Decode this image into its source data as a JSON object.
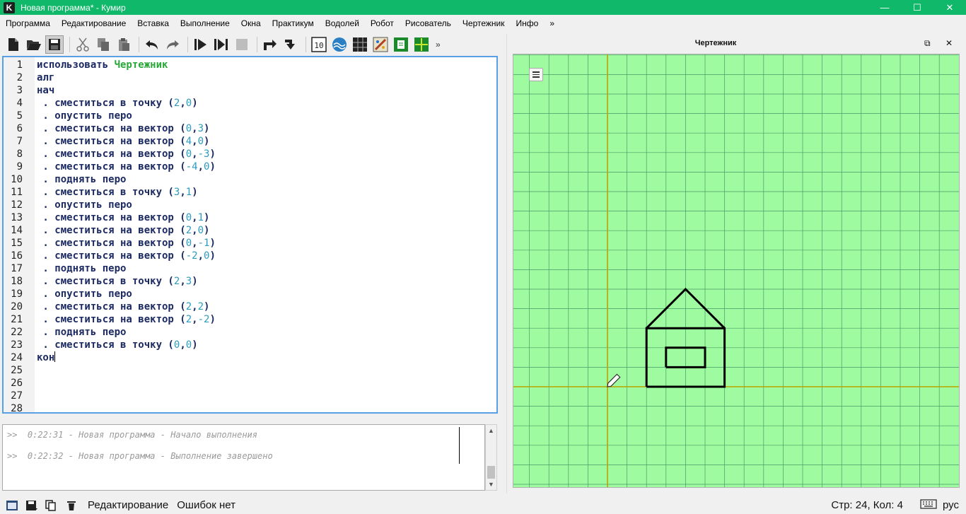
{
  "window": {
    "app_icon_letter": "K",
    "title": "Новая программа* - Кумир",
    "minimize": "—",
    "maximize": "☐",
    "close": "✕"
  },
  "menu": [
    "Программа",
    "Редактирование",
    "Вставка",
    "Выполнение",
    "Окна",
    "Практикум",
    "Водолей",
    "Робот",
    "Рисователь",
    "Чертежник",
    "Инфо",
    "»"
  ],
  "toolbar": {
    "icons": [
      "new-file-icon",
      "open-folder-icon",
      "save-icon",
      "cut-icon",
      "copy-icon",
      "paste-icon",
      "undo-icon",
      "redo-icon",
      "run-icon",
      "step-run-icon",
      "stop-icon",
      "step-over-icon",
      "step-into-icon",
      "counter-icon",
      "vodoley-icon",
      "robot-icon",
      "drawer-icon",
      "draftsman-icon",
      "grid-icon"
    ],
    "more": "»"
  },
  "editor": {
    "lines": [
      {
        "n": "1",
        "segs": [
          {
            "t": "использовать ",
            "c": "kw"
          },
          {
            "t": "Чертежник",
            "c": "mod"
          }
        ]
      },
      {
        "n": "2",
        "segs": [
          {
            "t": "алг",
            "c": "kw"
          }
        ]
      },
      {
        "n": "3",
        "segs": [
          {
            "t": "нач",
            "c": "kw"
          }
        ]
      },
      {
        "n": "4",
        "segs": [
          {
            "t": " . сместиться в точку (",
            "c": "kw"
          },
          {
            "t": "2",
            "c": "num"
          },
          {
            "t": ",",
            "c": "kw"
          },
          {
            "t": "0",
            "c": "num"
          },
          {
            "t": ")",
            "c": "kw"
          }
        ]
      },
      {
        "n": "5",
        "segs": [
          {
            "t": " . опустить перо",
            "c": "kw"
          }
        ]
      },
      {
        "n": "6",
        "segs": [
          {
            "t": " . сместиться на вектор (",
            "c": "kw"
          },
          {
            "t": "0",
            "c": "num"
          },
          {
            "t": ",",
            "c": "kw"
          },
          {
            "t": "3",
            "c": "num"
          },
          {
            "t": ")",
            "c": "kw"
          }
        ]
      },
      {
        "n": "7",
        "segs": [
          {
            "t": " . сместиться на вектор (",
            "c": "kw"
          },
          {
            "t": "4",
            "c": "num"
          },
          {
            "t": ",",
            "c": "kw"
          },
          {
            "t": "0",
            "c": "num"
          },
          {
            "t": ")",
            "c": "kw"
          }
        ]
      },
      {
        "n": "8",
        "segs": [
          {
            "t": " . сместиться на вектор (",
            "c": "kw"
          },
          {
            "t": "0",
            "c": "num"
          },
          {
            "t": ",",
            "c": "kw"
          },
          {
            "t": "-3",
            "c": "num"
          },
          {
            "t": ")",
            "c": "kw"
          }
        ]
      },
      {
        "n": "9",
        "segs": [
          {
            "t": " . сместиться на вектор (",
            "c": "kw"
          },
          {
            "t": "-4",
            "c": "num"
          },
          {
            "t": ",",
            "c": "kw"
          },
          {
            "t": "0",
            "c": "num"
          },
          {
            "t": ")",
            "c": "kw"
          }
        ]
      },
      {
        "n": "10",
        "segs": [
          {
            "t": " . поднять перо",
            "c": "kw"
          }
        ]
      },
      {
        "n": "11",
        "segs": [
          {
            "t": " . сместиться в точку (",
            "c": "kw"
          },
          {
            "t": "3",
            "c": "num"
          },
          {
            "t": ",",
            "c": "kw"
          },
          {
            "t": "1",
            "c": "num"
          },
          {
            "t": ")",
            "c": "kw"
          }
        ]
      },
      {
        "n": "12",
        "segs": [
          {
            "t": " . опустить перо",
            "c": "kw"
          }
        ]
      },
      {
        "n": "13",
        "segs": [
          {
            "t": " . сместиться на вектор (",
            "c": "kw"
          },
          {
            "t": "0",
            "c": "num"
          },
          {
            "t": ",",
            "c": "kw"
          },
          {
            "t": "1",
            "c": "num"
          },
          {
            "t": ")",
            "c": "kw"
          }
        ]
      },
      {
        "n": "14",
        "segs": [
          {
            "t": " . сместиться на вектор (",
            "c": "kw"
          },
          {
            "t": "2",
            "c": "num"
          },
          {
            "t": ",",
            "c": "kw"
          },
          {
            "t": "0",
            "c": "num"
          },
          {
            "t": ")",
            "c": "kw"
          }
        ]
      },
      {
        "n": "15",
        "segs": [
          {
            "t": " . сместиться на вектор (",
            "c": "kw"
          },
          {
            "t": "0",
            "c": "num"
          },
          {
            "t": ",",
            "c": "kw"
          },
          {
            "t": "-1",
            "c": "num"
          },
          {
            "t": ")",
            "c": "kw"
          }
        ]
      },
      {
        "n": "16",
        "segs": [
          {
            "t": " . сместиться на вектор (",
            "c": "kw"
          },
          {
            "t": "-2",
            "c": "num"
          },
          {
            "t": ",",
            "c": "kw"
          },
          {
            "t": "0",
            "c": "num"
          },
          {
            "t": ")",
            "c": "kw"
          }
        ]
      },
      {
        "n": "17",
        "segs": [
          {
            "t": " . поднять перо",
            "c": "kw"
          }
        ]
      },
      {
        "n": "18",
        "segs": [
          {
            "t": " . сместиться в точку (",
            "c": "kw"
          },
          {
            "t": "2",
            "c": "num"
          },
          {
            "t": ",",
            "c": "kw"
          },
          {
            "t": "3",
            "c": "num"
          },
          {
            "t": ")",
            "c": "kw"
          }
        ]
      },
      {
        "n": "19",
        "segs": [
          {
            "t": " . опустить перо",
            "c": "kw"
          }
        ]
      },
      {
        "n": "20",
        "segs": [
          {
            "t": " . сместиться на вектор (",
            "c": "kw"
          },
          {
            "t": "2",
            "c": "num"
          },
          {
            "t": ",",
            "c": "kw"
          },
          {
            "t": "2",
            "c": "num"
          },
          {
            "t": ")",
            "c": "kw"
          }
        ]
      },
      {
        "n": "21",
        "segs": [
          {
            "t": " . сместиться на вектор (",
            "c": "kw"
          },
          {
            "t": "2",
            "c": "num"
          },
          {
            "t": ",",
            "c": "kw"
          },
          {
            "t": "-2",
            "c": "num"
          },
          {
            "t": ")",
            "c": "kw"
          }
        ]
      },
      {
        "n": "22",
        "segs": [
          {
            "t": " . поднять перо",
            "c": "kw"
          }
        ]
      },
      {
        "n": "23",
        "segs": [
          {
            "t": " . сместиться в точку (",
            "c": "kw"
          },
          {
            "t": "0",
            "c": "num"
          },
          {
            "t": ",",
            "c": "kw"
          },
          {
            "t": "0",
            "c": "num"
          },
          {
            "t": ")",
            "c": "kw"
          }
        ]
      },
      {
        "n": "24",
        "segs": [
          {
            "t": "кон",
            "c": "kw"
          }
        ],
        "cursor": true
      },
      {
        "n": "25",
        "segs": []
      },
      {
        "n": "26",
        "segs": []
      },
      {
        "n": "27",
        "segs": []
      },
      {
        "n": "28",
        "segs": []
      }
    ]
  },
  "console": {
    "lines": [
      ">>  0:22:31 - Новая программа - Начало выполнения",
      ">>  0:22:32 - Новая программа - Выполнение завершено"
    ]
  },
  "panel": {
    "title": "Чертежник",
    "float_btn": "⧉",
    "close_btn": "✕",
    "colors": {
      "background": "#9ffb9f",
      "grid": "#4a9a6a",
      "axes": "#b8a400",
      "ink": "#000000"
    },
    "grid": {
      "x_min": -5,
      "x_max": 17,
      "y_min": -5,
      "y_max": 17
    },
    "pen_position": [
      0,
      0
    ],
    "drawing": [
      [
        [
          2,
          0
        ],
        [
          2,
          3
        ],
        [
          6,
          3
        ],
        [
          6,
          0
        ],
        [
          2,
          0
        ]
      ],
      [
        [
          3,
          1
        ],
        [
          3,
          2
        ],
        [
          5,
          2
        ],
        [
          5,
          1
        ],
        [
          3,
          1
        ]
      ],
      [
        [
          2,
          3
        ],
        [
          4,
          5
        ],
        [
          6,
          3
        ]
      ]
    ]
  },
  "status": {
    "mode": "Редактирование",
    "errors": "Ошибок нет",
    "position": "Стр: 24, Кол: 4",
    "keyboard_icon": "keyboard-icon",
    "lang": "рус"
  }
}
